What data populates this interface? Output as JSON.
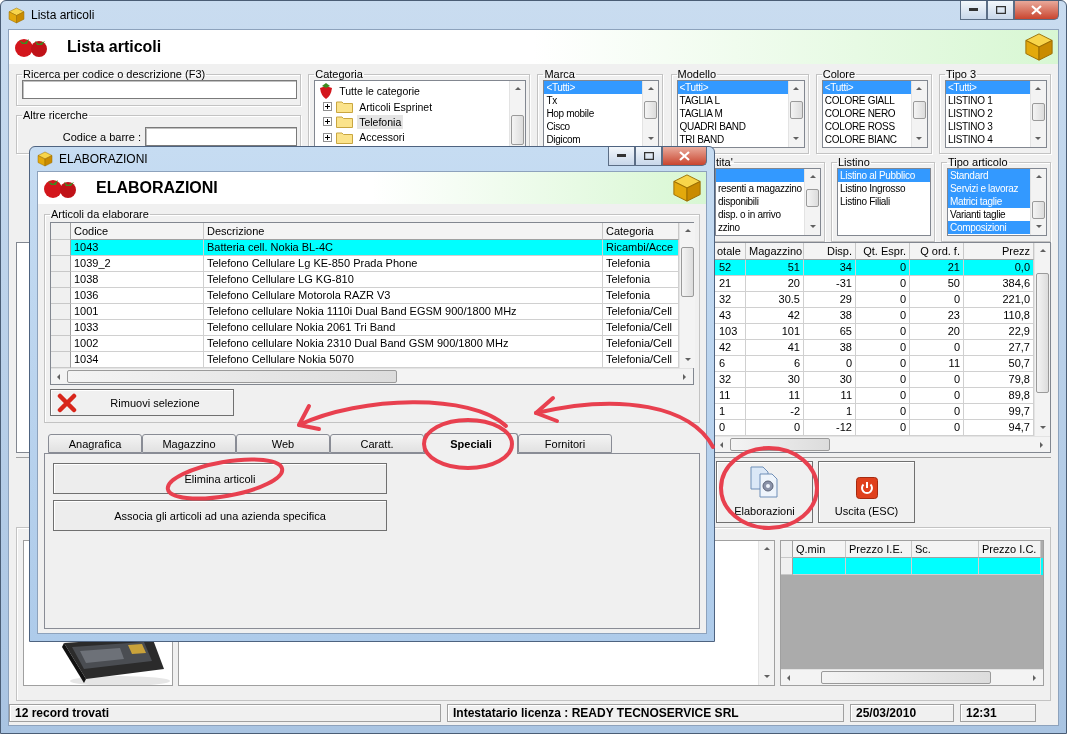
{
  "window": {
    "title": "Lista articoli",
    "header": "Lista articoli"
  },
  "search": {
    "label": "Ricerca per codice o descrizione (F3)"
  },
  "other_search": {
    "label": "Altre ricerche",
    "barcode_label": "Codice a barre :"
  },
  "category": {
    "label": "Categoria",
    "tree": [
      {
        "label": "Tutte le categorie",
        "selected": false,
        "children": [
          {
            "label": "Articoli Esprinet",
            "expanded": false,
            "selected": false
          },
          {
            "label": "Telefonia",
            "expanded": false,
            "selected": true
          },
          {
            "label": "Accessori",
            "expanded": false,
            "selected": false
          }
        ]
      }
    ]
  },
  "filters": [
    {
      "label": "Marca",
      "items": [
        {
          "text": "<Tutti>",
          "selected": true
        },
        {
          "text": "Tx",
          "selected": false
        },
        {
          "text": "Hop mobile",
          "selected": false
        },
        {
          "text": "Cisco",
          "selected": false
        },
        {
          "text": "Digicom",
          "selected": false
        }
      ]
    },
    {
      "label": "Modello",
      "items": [
        {
          "text": "<Tutti>",
          "selected": true
        },
        {
          "text": "TAGLIA L",
          "selected": false
        },
        {
          "text": "TAGLIA M",
          "selected": false
        },
        {
          "text": "QUADRI BAND",
          "selected": false
        },
        {
          "text": "TRI BAND",
          "selected": false
        }
      ]
    },
    {
      "label": "Colore",
      "items": [
        {
          "text": "<Tutti>",
          "selected": true
        },
        {
          "text": "COLORE GIALL",
          "selected": false
        },
        {
          "text": "COLORE NERO",
          "selected": false
        },
        {
          "text": "COLORE ROSS",
          "selected": false
        },
        {
          "text": "COLORE BIANC",
          "selected": false
        }
      ]
    },
    {
      "label": "Tipo 3",
      "items": [
        {
          "text": "<Tutti>",
          "selected": true
        },
        {
          "text": "LISTINO 1",
          "selected": false
        },
        {
          "text": "LISTINO 2",
          "selected": false
        },
        {
          "text": "LISTINO 3",
          "selected": false
        },
        {
          "text": "LISTINO 4",
          "selected": false
        }
      ]
    }
  ],
  "filters_row2": [
    {
      "label": "tita'",
      "items": [
        {
          "selected": true
        },
        {
          "text": "resenti a magazzino",
          "selected": false
        },
        {
          "text": "disponibili",
          "selected": false
        },
        {
          "text": "disp. o in arrivo",
          "selected": false
        },
        {
          "text": "zzino",
          "selected": false
        }
      ]
    },
    {
      "label": "Listino",
      "items": [
        {
          "text": "Listino al Pubblico",
          "selected": true
        },
        {
          "text": "Listino Ingrosso",
          "selected": false
        },
        {
          "text": "Listino Filiali",
          "selected": false
        }
      ]
    },
    {
      "label": "Tipo articolo",
      "items": [
        {
          "text": "Standard",
          "selected": true
        },
        {
          "text": "Servizi e lavoraz",
          "selected": true
        },
        {
          "text": "Matrici taglie",
          "selected": true
        },
        {
          "text": "Varianti taglie",
          "selected": false
        },
        {
          "text": "Composizioni",
          "selected": true
        }
      ]
    }
  ],
  "main_table": {
    "columns": [
      "otale",
      "Magazzino",
      "Disp.",
      "Qt. Espr.",
      "Q ord. f.",
      "Prezz"
    ],
    "rows": [
      {
        "selected": true,
        "cells": [
          "52",
          "51",
          "34",
          "0",
          "21",
          "0,0"
        ]
      },
      {
        "selected": false,
        "cells": [
          "21",
          "20",
          "-31",
          "0",
          "50",
          "384,6"
        ]
      },
      {
        "selected": false,
        "cells": [
          "32",
          "30.5",
          "29",
          "0",
          "0",
          "221,0"
        ]
      },
      {
        "selected": false,
        "cells": [
          "43",
          "42",
          "38",
          "0",
          "23",
          "110,8"
        ]
      },
      {
        "selected": false,
        "cells": [
          "103",
          "101",
          "65",
          "0",
          "20",
          "22,9"
        ]
      },
      {
        "selected": false,
        "cells": [
          "42",
          "41",
          "38",
          "0",
          "0",
          "27,7"
        ]
      },
      {
        "selected": false,
        "cells": [
          "6",
          "6",
          "0",
          "0",
          "11",
          "50,7"
        ]
      },
      {
        "selected": false,
        "cells": [
          "32",
          "30",
          "30",
          "0",
          "0",
          "79,8"
        ]
      },
      {
        "selected": false,
        "cells": [
          "11",
          "11",
          "11",
          "0",
          "0",
          "89,8"
        ]
      },
      {
        "selected": false,
        "cells": [
          "1",
          "-2",
          "1",
          "0",
          "0",
          "99,7"
        ]
      },
      {
        "selected": false,
        "cells": [
          "0",
          "0",
          "-12",
          "0",
          "0",
          "94,7"
        ]
      }
    ]
  },
  "actions": [
    {
      "label": "Elaborazioni",
      "kind": "process"
    },
    {
      "label": "Uscita (ESC)",
      "kind": "exit"
    }
  ],
  "price_table": {
    "columns": [
      "Q.min",
      "Prezzo I.E.",
      "Sc.",
      "Prezzo I.C."
    ],
    "rows": [
      {
        "selected": true
      }
    ]
  },
  "status_bar": [
    "12 record trovati",
    "Intestatario licenza : READY TECNOSERVICE SRL",
    "25/03/2010",
    "12:31"
  ],
  "dialog": {
    "title": "ELABORAZIONI",
    "header": "ELABORAZIONI",
    "group": "Articoli da elaborare",
    "table": {
      "columns": [
        "Codice",
        "Descrizione",
        "Categoria"
      ],
      "rows": [
        {
          "selected": true,
          "cells": [
            "1043",
            "Batteria cell. Nokia BL-4C",
            "Ricambi/Acce"
          ]
        },
        {
          "selected": false,
          "cells": [
            "1039_2",
            "Telefono Cellulare Lg KE-850 Prada Phone",
            "Telefonia"
          ]
        },
        {
          "selected": false,
          "cells": [
            "1038",
            "Telefono Cellulare LG KG-810",
            "Telefonia"
          ]
        },
        {
          "selected": false,
          "cells": [
            "1036",
            "Telefono Cellulare Motorola RAZR V3",
            "Telefonia"
          ]
        },
        {
          "selected": false,
          "cells": [
            "1001",
            "Telefono cellulare Nokia 1110i Dual Band EGSM 900/1800 MHz",
            "Telefonia/Cell"
          ]
        },
        {
          "selected": false,
          "cells": [
            "1033",
            "Telefono cellulare Nokia 2061 Tri Band",
            "Telefonia/Cell"
          ]
        },
        {
          "selected": false,
          "cells": [
            "1002",
            "Telefono cellulare Nokia 2310 Dual Band GSM 900/1800 MHz",
            "Telefonia/Cell"
          ]
        },
        {
          "selected": false,
          "cells": [
            "1034",
            "Telefono Cellulare Nokia 5070",
            "Telefonia/Cell"
          ]
        }
      ]
    },
    "remove_button": "Rimuovi selezione",
    "tabs": [
      {
        "label": "Anagrafica",
        "selected": false
      },
      {
        "label": "Magazzino",
        "selected": false
      },
      {
        "label": "Web",
        "selected": false
      },
      {
        "label": "Caratt.",
        "selected": false
      },
      {
        "label": "Speciali",
        "selected": true
      },
      {
        "label": "Fornitori",
        "selected": false
      }
    ],
    "buttons": [
      "Elimina articoli",
      "Associa gli articoli ad una azienda specifica"
    ]
  }
}
